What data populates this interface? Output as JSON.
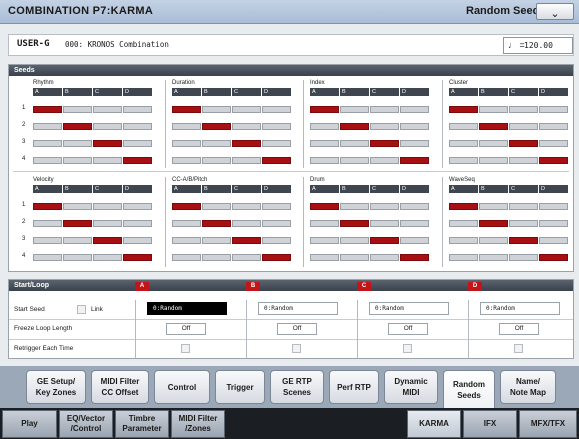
{
  "title": "COMBINATION P7:KARMA",
  "page_name": "Random Seeds",
  "program": {
    "id": "USER-G",
    "name": "000: KRONOS Combination"
  },
  "tempo": {
    "symbol": "♩ =",
    "value": "120.00"
  },
  "seeds": {
    "header": "Seeds",
    "columns": [
      "A",
      "B",
      "C",
      "D"
    ],
    "row_numbers": [
      "1",
      "2",
      "3",
      "4"
    ],
    "groups": [
      {
        "label": "Rhythm"
      },
      {
        "label": "Duration"
      },
      {
        "label": "Index"
      },
      {
        "label": "Cluster"
      },
      {
        "label": "Velocity"
      },
      {
        "label": "CC-A/B/Pitch"
      },
      {
        "label": "Drum"
      },
      {
        "label": "WaveSeq"
      }
    ]
  },
  "startloop": {
    "header": "Start/Loop",
    "letters": [
      "A",
      "B",
      "C",
      "D"
    ],
    "start_seed_label": "Start Seed",
    "link_label": "Link",
    "start_values": [
      "0:Random",
      "0:Random",
      "0:Random",
      "0:Random"
    ],
    "freeze_label": "Freeze Loop Length",
    "freeze_values": [
      "Off",
      "Off",
      "Off",
      "Off"
    ],
    "retrigger_label": "Retrigger Each Time"
  },
  "tabs": [
    {
      "label": "GE Setup/\nKey Zones"
    },
    {
      "label": "MIDI Filter\nCC Offset"
    },
    {
      "label": "Control"
    },
    {
      "label": "Trigger"
    },
    {
      "label": "GE RTP\nScenes"
    },
    {
      "label": "Perf RTP"
    },
    {
      "label": "Dynamic\nMIDI"
    },
    {
      "label": "Random\nSeeds"
    },
    {
      "label": "Name/\nNote Map"
    }
  ],
  "bottom_tabs": [
    {
      "label": "Play"
    },
    {
      "label": "EQ/Vector\n/Control"
    },
    {
      "label": "Timbre\nParameter"
    },
    {
      "label": "MIDI Filter\n/Zones"
    },
    {
      "label": "KARMA"
    },
    {
      "label": "IFX"
    },
    {
      "label": "MFX/TFX"
    }
  ],
  "colors": {
    "active_seed": "#a80f12",
    "letter_badge": "#c2151a"
  }
}
